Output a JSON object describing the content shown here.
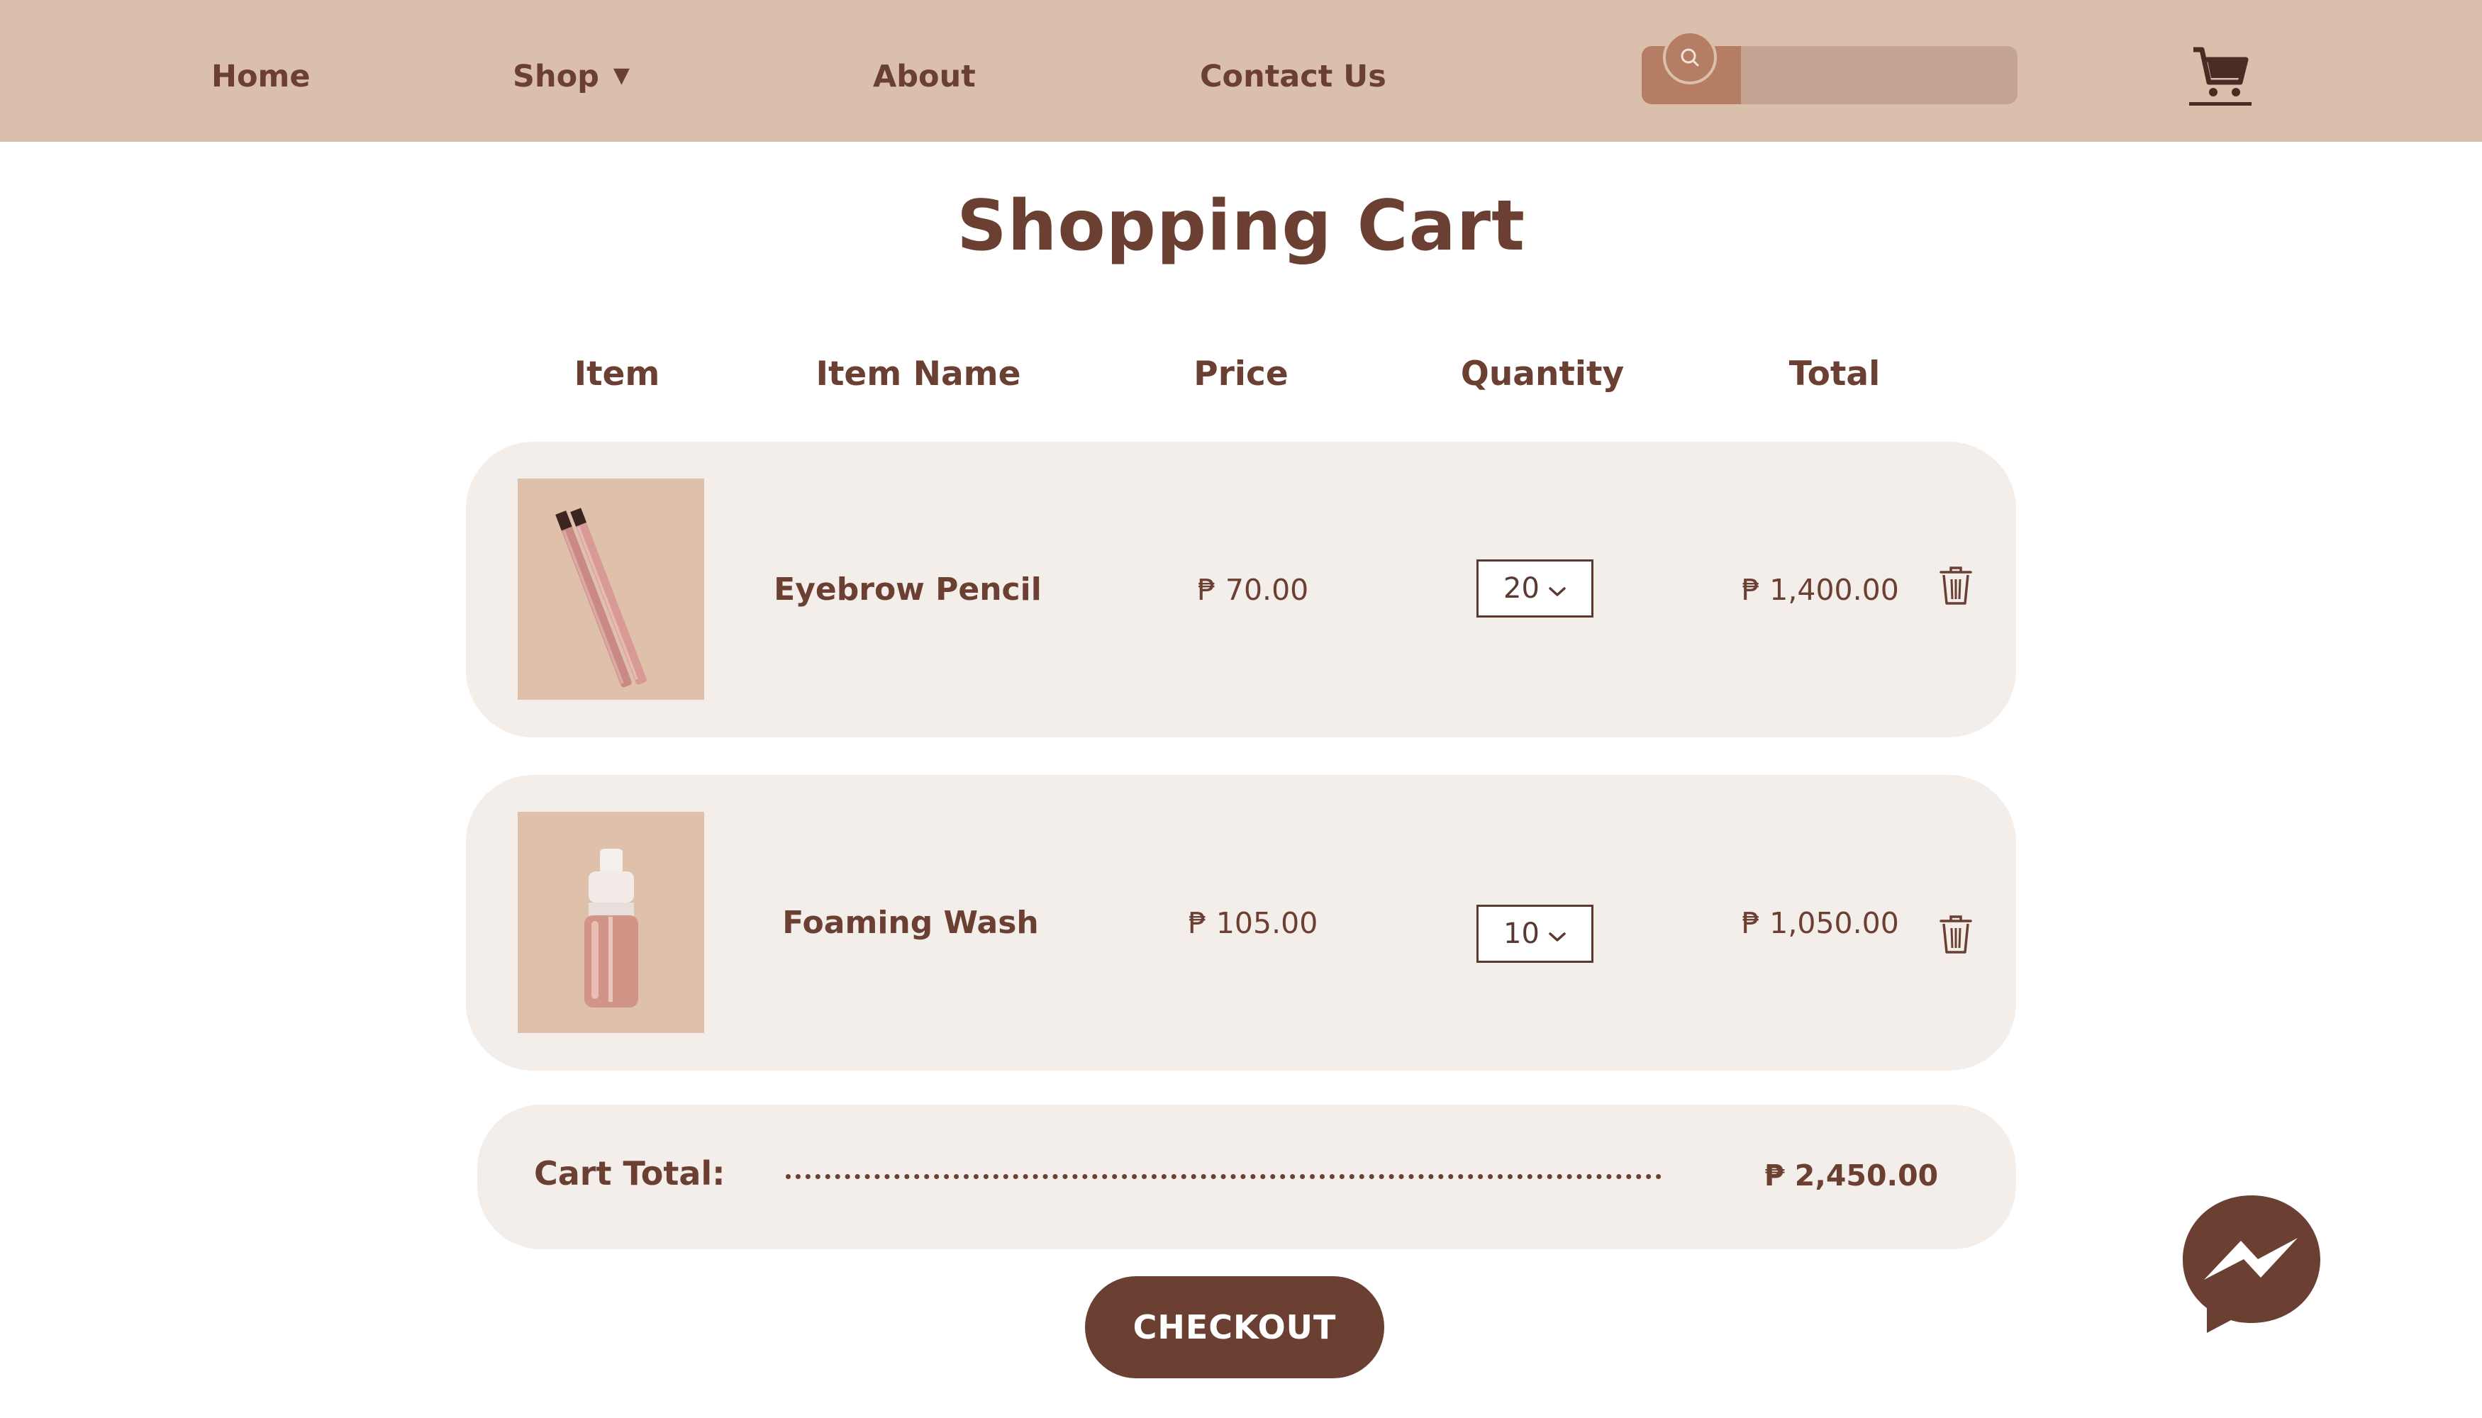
{
  "nav": {
    "home": "Home",
    "shop": "Shop",
    "shop_caret": "▼",
    "about": "About",
    "contact": "Contact Us",
    "search_value": "",
    "search_placeholder": ""
  },
  "page": {
    "title": "Shopping Cart"
  },
  "table": {
    "headers": {
      "item": "Item",
      "name": "Item Name",
      "price": "Price",
      "quantity": "Quantity",
      "total": "Total"
    }
  },
  "cart": {
    "items": [
      {
        "image": "eyebrow-pencil",
        "name": "Eyebrow Pencil",
        "price": "₱ 70.00",
        "quantity": "20",
        "total": "₱ 1,400.00"
      },
      {
        "image": "foaming-wash-bottle",
        "name": "Foaming Wash",
        "price": "₱ 105.00",
        "quantity": "10",
        "total": "₱ 1,050.00"
      }
    ],
    "total_label": "Cart Total:",
    "total_value": "₱ 2,450.00",
    "checkout": "CHECKOUT"
  },
  "icons": {
    "search": "search-icon",
    "cart": "shopping-cart-icon",
    "trash": "trash-icon",
    "chevron": "chevron-down-icon",
    "messenger": "messenger-icon"
  },
  "colors": {
    "navbar": "#dbbfad",
    "primary_text": "#6b4033",
    "row_background": "#f3eeea",
    "search_accent": "#b57d63",
    "search_field": "#c4a393",
    "checkout_button": "#6b4033"
  }
}
